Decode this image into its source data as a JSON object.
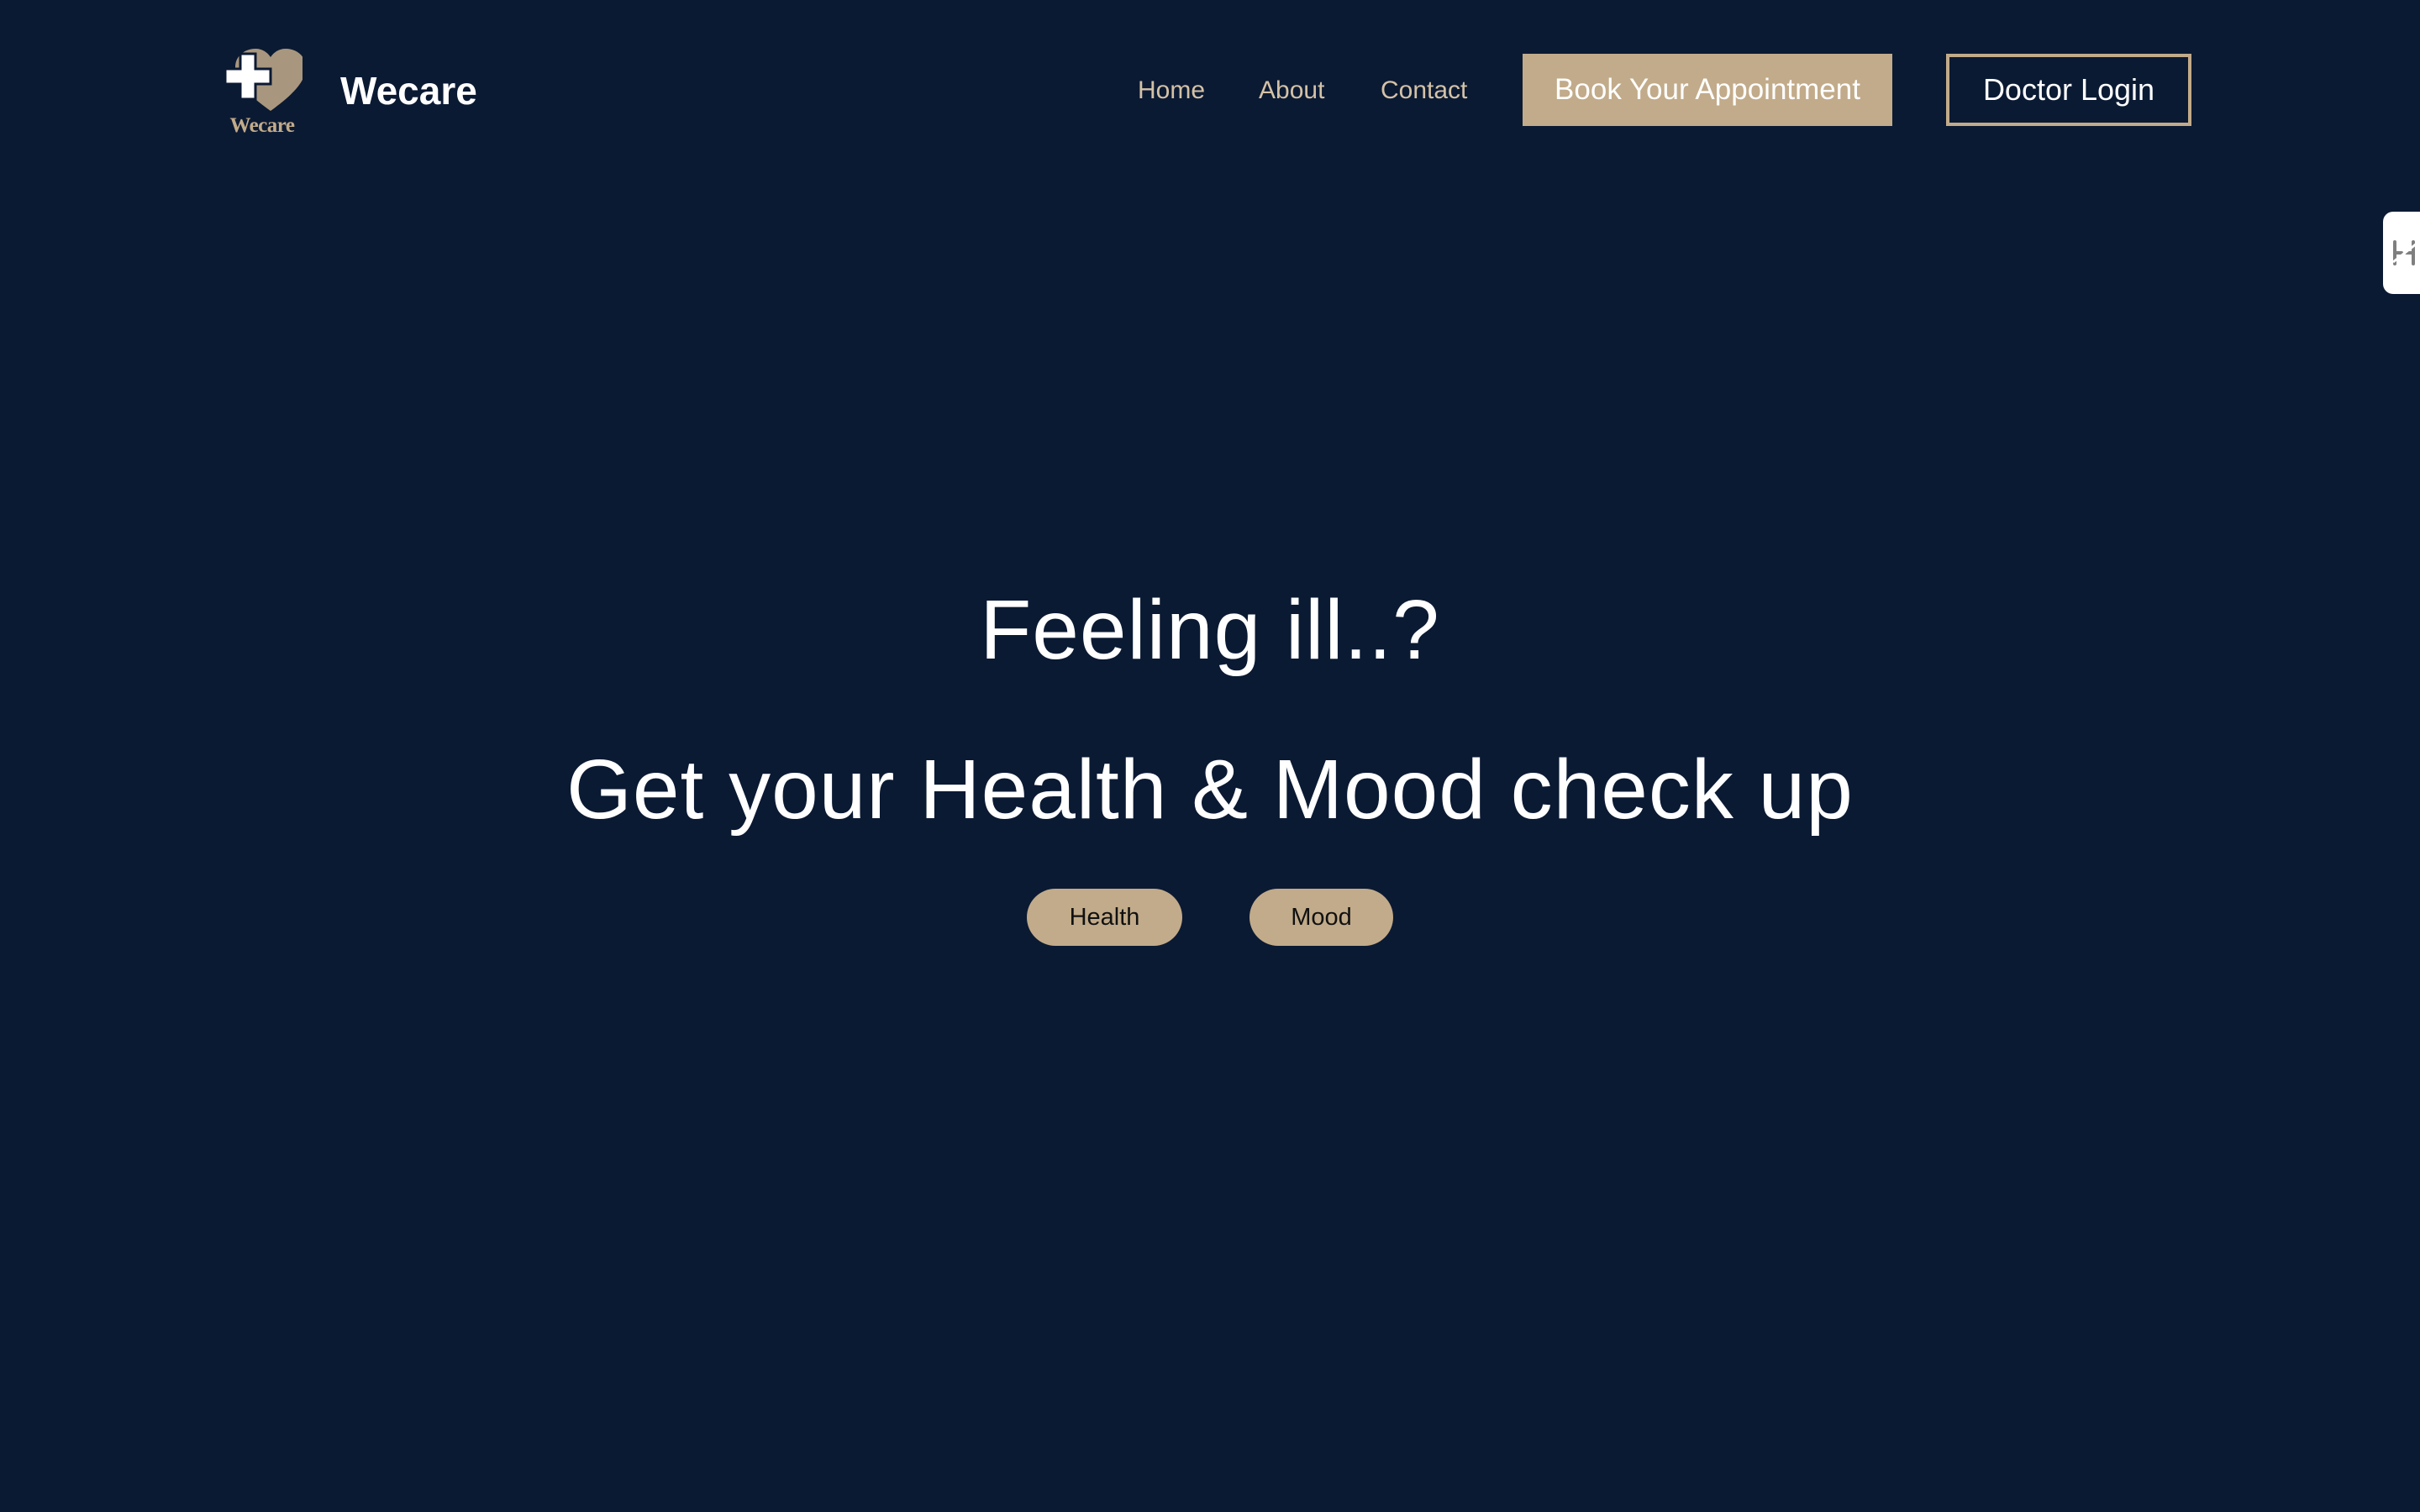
{
  "header": {
    "logo_caption": "Wecare",
    "brand_name": "Wecare",
    "nav": {
      "home": "Home",
      "about": "About",
      "contact": "Contact"
    },
    "book_button": "Book Your Appointment",
    "login_button": "Doctor Login"
  },
  "hero": {
    "title": "Feeling ill..?",
    "subtitle": "Get your Health & Mood check up",
    "options": {
      "health": "Health",
      "mood": "Mood"
    }
  },
  "colors": {
    "background": "#0b1a33",
    "accent": "#c2ab8a",
    "text": "#ffffff",
    "nav_text": "#d4c2a7"
  },
  "icons": {
    "logo": "heart-with-medical-cross-icon",
    "side_tab": "hyphenation-icon"
  }
}
